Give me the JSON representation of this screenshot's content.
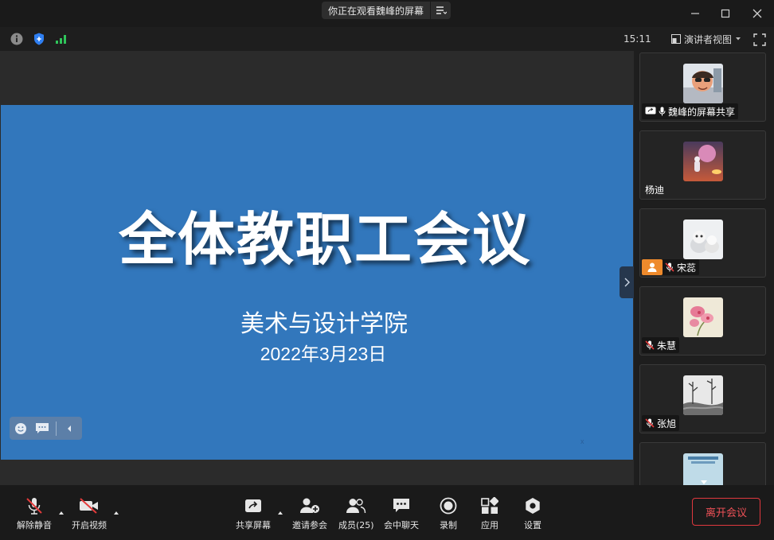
{
  "titlebar": {
    "view_label": "你正在观看魏峰的屏幕",
    "menu_icon": "list-menu-icon"
  },
  "statusbar": {
    "time": "15:11",
    "view_mode": "演讲者视图",
    "icons": [
      "info-icon",
      "shield-icon",
      "signal-icon",
      "fullscreen-icon"
    ],
    "colors": {
      "shield": "#2f7ff2",
      "signal": "#2fc45a"
    }
  },
  "slide": {
    "title": "全体教职工会议",
    "subtitle": "美术与设计学院",
    "date": "2022年3月23日",
    "mark": "x",
    "background": "#3277bc"
  },
  "participants": [
    {
      "name": "魏峰的屏幕共享",
      "status_icons": [
        "screen-share-icon",
        "mic-icon"
      ]
    },
    {
      "name": "杨迪",
      "status_icons": []
    },
    {
      "name": "宋蕊",
      "status_icons": [
        "host-icon",
        "mic-muted-icon"
      ]
    },
    {
      "name": "朱慧",
      "status_icons": [
        "mic-muted-icon"
      ]
    },
    {
      "name": "张旭",
      "status_icons": [
        "mic-muted-icon"
      ]
    },
    {
      "name": "",
      "status_icons": []
    }
  ],
  "toolbar": {
    "unmute": "解除静音",
    "start_video": "开启视频",
    "share_screen": "共享屏幕",
    "invite": "邀请参会",
    "members": "成员(25)",
    "chat": "会中聊天",
    "record": "录制",
    "apps": "应用",
    "settings": "设置",
    "leave": "离开会议",
    "leave_color": "#e0383e"
  }
}
